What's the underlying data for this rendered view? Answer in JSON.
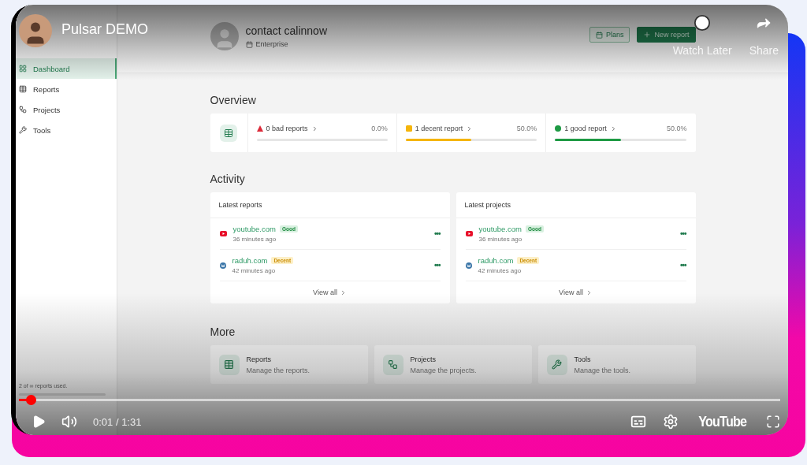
{
  "video": {
    "title": "Pulsar DEMO",
    "actions": [
      {
        "kind": "watch_later",
        "label": "Watch Later"
      },
      {
        "kind": "share",
        "label": "Share"
      }
    ],
    "progress": {
      "level": 0.016
    },
    "time": "0:01 / 1:31",
    "brand": "YouTube"
  },
  "sidebar": {
    "items": [
      {
        "label": "Dashboard",
        "selected": true
      },
      {
        "label": "Reports",
        "selected": false
      },
      {
        "label": "Projects",
        "selected": false
      },
      {
        "label": "Tools",
        "selected": false
      }
    ],
    "usage": "2 of ∞ reports used."
  },
  "header": {
    "name": "contact calinnow",
    "plan": "Enterprise",
    "buttons": [
      {
        "kind": "outline",
        "label": "Plans"
      },
      {
        "kind": "primary",
        "label": "New report"
      }
    ]
  },
  "overview": {
    "title": "Overview",
    "stats": [
      {
        "kind": "triangle",
        "label": "0 bad reports",
        "percent": "0.0%",
        "color": "#dc2b3a"
      },
      {
        "kind": "square",
        "label": "1 decent report",
        "percent": "50.0%",
        "level": 0.5,
        "color": "#f5b50a"
      },
      {
        "kind": "circle",
        "label": "1 good report",
        "percent": "50.0%",
        "level": 0.5,
        "color": "#1e9a44"
      }
    ]
  },
  "activity": {
    "title": "Activity",
    "cards": [
      {
        "title": "Latest reports",
        "rows": [
          {
            "site": {
              "kind": "video",
              "label": "youtube.com"
            },
            "tag": {
              "kind": "good",
              "label": "Good"
            },
            "time": "36 minutes ago",
            "menu": "•••"
          },
          {
            "site": {
              "kind": "blog",
              "label": "raduh.com"
            },
            "tag": {
              "kind": "decent",
              "label": "Decent"
            },
            "time": "42 minutes ago",
            "menu": "•••"
          }
        ],
        "more": "View all"
      },
      {
        "title": "Latest projects",
        "rows": [
          {
            "site": {
              "kind": "video",
              "label": "youtube.com"
            },
            "tag": {
              "kind": "good",
              "label": "Good"
            },
            "time": "36 minutes ago",
            "menu": "•••"
          },
          {
            "site": {
              "kind": "blog",
              "label": "raduh.com"
            },
            "tag": {
              "kind": "decent",
              "label": "Decent"
            },
            "time": "42 minutes ago",
            "menu": "•••"
          }
        ],
        "more": "View all"
      }
    ]
  },
  "more": {
    "title": "More",
    "cards": [
      {
        "title": "Reports",
        "text": "Manage the reports."
      },
      {
        "title": "Projects",
        "text": "Manage the projects."
      },
      {
        "title": "Tools",
        "text": "Manage the tools."
      }
    ]
  }
}
